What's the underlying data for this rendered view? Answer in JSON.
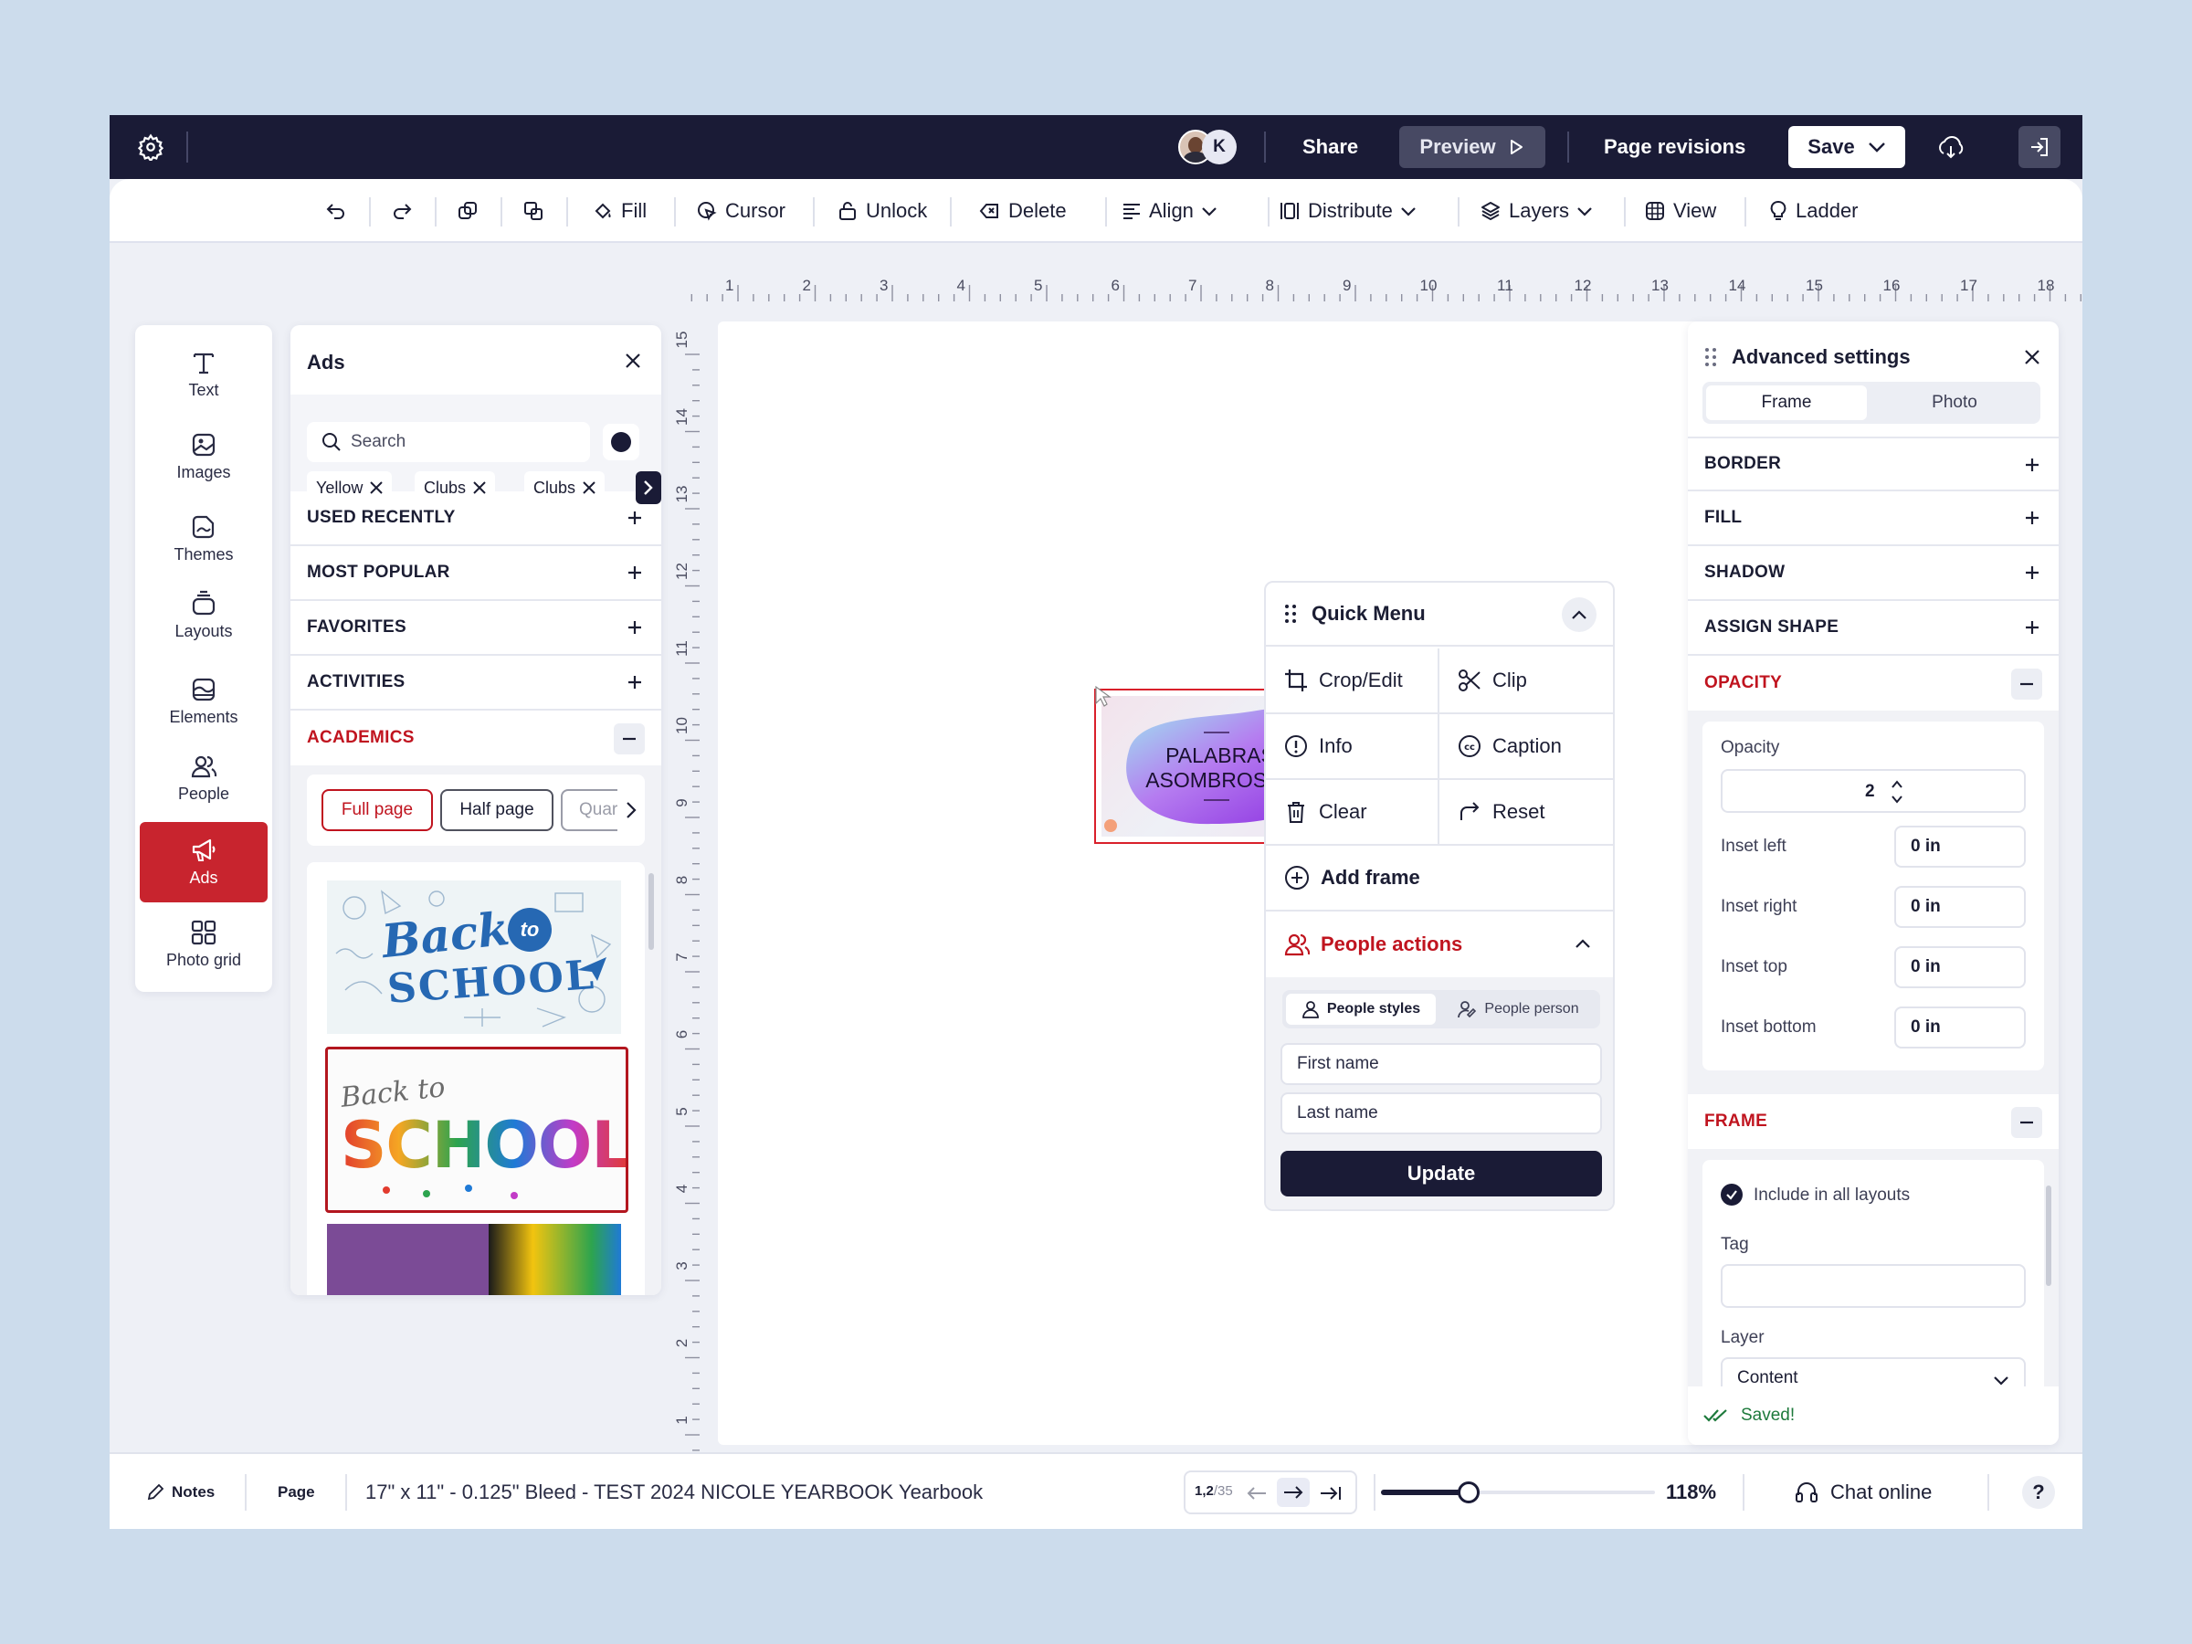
{
  "topbar": {
    "avatar_initial": "K",
    "share": "Share",
    "preview": "Preview",
    "page_revisions": "Page revisions",
    "save": "Save"
  },
  "toolbar": {
    "fill": "Fill",
    "cursor": "Cursor",
    "unlock": "Unlock",
    "delete": "Delete",
    "align": "Align",
    "distribute": "Distribute",
    "layers": "Layers",
    "view": "View",
    "ladder": "Ladder"
  },
  "rulers": {
    "horizontal": [
      "1",
      "2",
      "3",
      "4",
      "5",
      "6",
      "7",
      "8",
      "9",
      "10",
      "11",
      "12",
      "13",
      "14",
      "15",
      "16",
      "17",
      "18"
    ],
    "vertical": [
      "15",
      "14",
      "13",
      "12",
      "11",
      "10",
      "9",
      "8",
      "7",
      "6",
      "5",
      "4",
      "3",
      "2",
      "1"
    ]
  },
  "sidebar": {
    "items": [
      {
        "label": "Text",
        "icon": "text-icon"
      },
      {
        "label": "Images",
        "icon": "images-icon"
      },
      {
        "label": "Themes",
        "icon": "themes-icon"
      },
      {
        "label": "Layouts",
        "icon": "layouts-icon"
      },
      {
        "label": "Elements",
        "icon": "elements-icon"
      },
      {
        "label": "People",
        "icon": "people-icon"
      },
      {
        "label": "Ads",
        "icon": "megaphone-icon",
        "active": true
      },
      {
        "label": "Photo grid",
        "icon": "grid-icon"
      }
    ]
  },
  "ads_panel": {
    "title": "Ads",
    "search_placeholder": "Search",
    "chips": [
      "Yellow",
      "Clubs",
      "Clubs"
    ],
    "sections": [
      "USED RECENTLY",
      "MOST POPULAR",
      "FAVORITES",
      "ACTIVITIES",
      "ACADEMICS"
    ],
    "filters": [
      "Full page",
      "Half page",
      "Quarter"
    ],
    "thumbnails": [
      {
        "line1": "Back",
        "line1b": "to",
        "line2": "SCHOOL"
      },
      {
        "line1": "Back to",
        "line2": "SCHOOL"
      }
    ]
  },
  "canvas_element": {
    "line1": "PALABRAS",
    "line2": "ASOMBROSAS"
  },
  "quick_menu": {
    "title": "Quick Menu",
    "crop_edit": "Crop/Edit",
    "clip": "Clip",
    "info": "Info",
    "caption": "Caption",
    "clear": "Clear",
    "reset": "Reset",
    "add_frame": "Add frame",
    "people_actions": "People actions",
    "people_styles": "People styles",
    "people_person": "People person",
    "first_name_placeholder": "First name",
    "last_name_placeholder": "Last name",
    "update": "Update"
  },
  "advanced": {
    "title": "Advanced settings",
    "tabs": [
      "Frame",
      "Photo"
    ],
    "sections": [
      "BORDER",
      "FILL",
      "SHADOW",
      "ASSIGN SHAPE"
    ],
    "opacity_section": "OPACITY",
    "opacity_label": "Opacity",
    "opacity_value": "2",
    "inset_left_label": "Inset left",
    "inset_left": "0 in",
    "inset_right_label": "Inset right",
    "inset_right": "0 in",
    "inset_top_label": "Inset top",
    "inset_top": "0 in",
    "inset_bottom_label": "Inset bottom",
    "inset_bottom": "0 in",
    "frame_section": "FRAME",
    "include_all": "Include in all layouts",
    "tag_label": "Tag",
    "layer_label": "Layer",
    "layer_value": "Content",
    "saved": "Saved!"
  },
  "bottombar": {
    "notes": "Notes",
    "page": "Page",
    "doc_title": "17\" x 11\" - 0.125\" Bleed - TEST 2024 NICOLE YEARBOOK Yearbook",
    "page_current": "1,2",
    "page_total": "/35",
    "zoom": "118%",
    "zoom_fraction": 0.32,
    "chat": "Chat online",
    "help": "?"
  },
  "colors": {
    "accent": "#c8242e",
    "dark": "#1a1b36"
  }
}
